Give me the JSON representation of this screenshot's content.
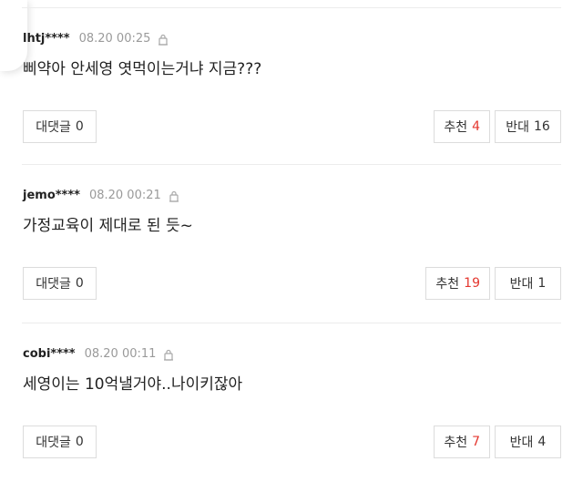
{
  "comments": [
    {
      "author": "lhtj****",
      "time": "08.20 00:25",
      "text": "삐약아 안세영 엿먹이는거냐 지금???",
      "reply_label": "대댓글",
      "reply_count": "0",
      "recommend_label": "추천",
      "recommend_count": "4",
      "oppose_label": "반대",
      "oppose_count": "16"
    },
    {
      "author": "jemo****",
      "time": "08.20 00:21",
      "text": "가정교육이 제대로 된 듯~",
      "reply_label": "대댓글",
      "reply_count": "0",
      "recommend_label": "추천",
      "recommend_count": "19",
      "oppose_label": "반대",
      "oppose_count": "1"
    },
    {
      "author": "cobi****",
      "time": "08.20 00:11",
      "text": "세영이는 10억낼거야..나이키잖아",
      "reply_label": "대댓글",
      "reply_count": "0",
      "recommend_label": "추천",
      "recommend_count": "7",
      "oppose_label": "반대",
      "oppose_count": "4"
    }
  ],
  "colors": {
    "recommend_count": "#e4372f",
    "meta_text": "#9a9a9a",
    "border": "#dcdcdc"
  },
  "icons": {
    "meta": "lock-icon"
  }
}
